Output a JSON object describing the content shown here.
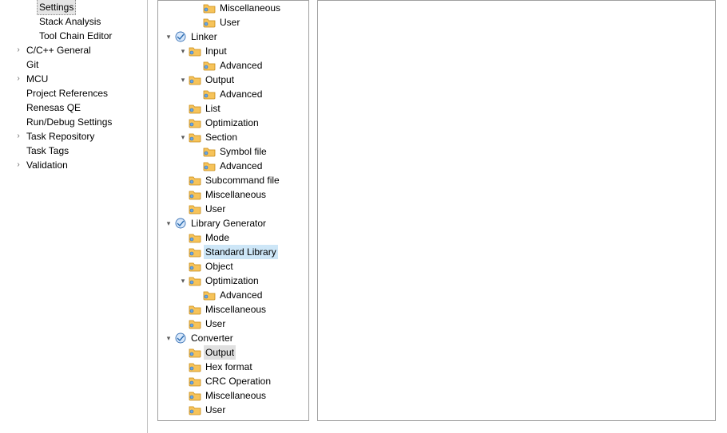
{
  "left_tree": {
    "items": [
      {
        "twisty": "",
        "indent": "indent2",
        "label": "Settings",
        "selected": true
      },
      {
        "twisty": "",
        "indent": "indent2",
        "label": "Stack Analysis",
        "selected": false
      },
      {
        "twisty": "",
        "indent": "indent2",
        "label": "Tool Chain Editor",
        "selected": false
      },
      {
        "twisty": ">",
        "indent": "indent1",
        "label": "C/C++ General",
        "selected": false
      },
      {
        "twisty": "",
        "indent": "indent1",
        "label": "Git",
        "selected": false
      },
      {
        "twisty": ">",
        "indent": "indent1",
        "label": "MCU",
        "selected": false
      },
      {
        "twisty": "",
        "indent": "indent1",
        "label": "Project References",
        "selected": false
      },
      {
        "twisty": "",
        "indent": "indent1",
        "label": "Renesas QE",
        "selected": false
      },
      {
        "twisty": "",
        "indent": "indent1",
        "label": "Run/Debug Settings",
        "selected": false
      },
      {
        "twisty": ">",
        "indent": "indent1",
        "label": "Task Repository",
        "selected": false
      },
      {
        "twisty": "",
        "indent": "indent1",
        "label": "Task Tags",
        "selected": false
      },
      {
        "twisty": ">",
        "indent": "indent1",
        "label": "Validation",
        "selected": false
      }
    ]
  },
  "tool_tree": {
    "nodes": [
      {
        "depth": 3,
        "twisty": "",
        "icon": "folder",
        "label": "Miscellaneous",
        "hl": ""
      },
      {
        "depth": 3,
        "twisty": "",
        "icon": "folder",
        "label": "User",
        "hl": ""
      },
      {
        "depth": 1,
        "twisty": "v",
        "icon": "tool",
        "label": "Linker",
        "hl": ""
      },
      {
        "depth": 2,
        "twisty": "v",
        "icon": "folder",
        "label": "Input",
        "hl": ""
      },
      {
        "depth": 3,
        "twisty": "",
        "icon": "folder",
        "label": "Advanced",
        "hl": ""
      },
      {
        "depth": 2,
        "twisty": "v",
        "icon": "folder",
        "label": "Output",
        "hl": ""
      },
      {
        "depth": 3,
        "twisty": "",
        "icon": "folder",
        "label": "Advanced",
        "hl": ""
      },
      {
        "depth": 2,
        "twisty": "",
        "icon": "folder",
        "label": "List",
        "hl": ""
      },
      {
        "depth": 2,
        "twisty": "",
        "icon": "folder",
        "label": "Optimization",
        "hl": ""
      },
      {
        "depth": 2,
        "twisty": "v",
        "icon": "folder",
        "label": "Section",
        "hl": ""
      },
      {
        "depth": 3,
        "twisty": "",
        "icon": "folder",
        "label": "Symbol file",
        "hl": ""
      },
      {
        "depth": 3,
        "twisty": "",
        "icon": "folder",
        "label": "Advanced",
        "hl": ""
      },
      {
        "depth": 2,
        "twisty": "",
        "icon": "folder",
        "label": "Subcommand file",
        "hl": ""
      },
      {
        "depth": 2,
        "twisty": "",
        "icon": "folder",
        "label": "Miscellaneous",
        "hl": ""
      },
      {
        "depth": 2,
        "twisty": "",
        "icon": "folder",
        "label": "User",
        "hl": ""
      },
      {
        "depth": 1,
        "twisty": "v",
        "icon": "tool",
        "label": "Library Generator",
        "hl": ""
      },
      {
        "depth": 2,
        "twisty": "",
        "icon": "folder",
        "label": "Mode",
        "hl": ""
      },
      {
        "depth": 2,
        "twisty": "",
        "icon": "folder",
        "label": "Standard Library",
        "hl": "hl-blue"
      },
      {
        "depth": 2,
        "twisty": "",
        "icon": "folder",
        "label": "Object",
        "hl": ""
      },
      {
        "depth": 2,
        "twisty": "v",
        "icon": "folder",
        "label": "Optimization",
        "hl": ""
      },
      {
        "depth": 3,
        "twisty": "",
        "icon": "folder",
        "label": "Advanced",
        "hl": ""
      },
      {
        "depth": 2,
        "twisty": "",
        "icon": "folder",
        "label": "Miscellaneous",
        "hl": ""
      },
      {
        "depth": 2,
        "twisty": "",
        "icon": "folder",
        "label": "User",
        "hl": ""
      },
      {
        "depth": 1,
        "twisty": "v",
        "icon": "tool",
        "label": "Converter",
        "hl": ""
      },
      {
        "depth": 2,
        "twisty": "",
        "icon": "folder",
        "label": "Output",
        "hl": "hl-gray"
      },
      {
        "depth": 2,
        "twisty": "",
        "icon": "folder",
        "label": "Hex format",
        "hl": ""
      },
      {
        "depth": 2,
        "twisty": "",
        "icon": "folder",
        "label": "CRC Operation",
        "hl": ""
      },
      {
        "depth": 2,
        "twisty": "",
        "icon": "folder",
        "label": "Miscellaneous",
        "hl": ""
      },
      {
        "depth": 2,
        "twisty": "",
        "icon": "folder",
        "label": "User",
        "hl": ""
      }
    ]
  }
}
